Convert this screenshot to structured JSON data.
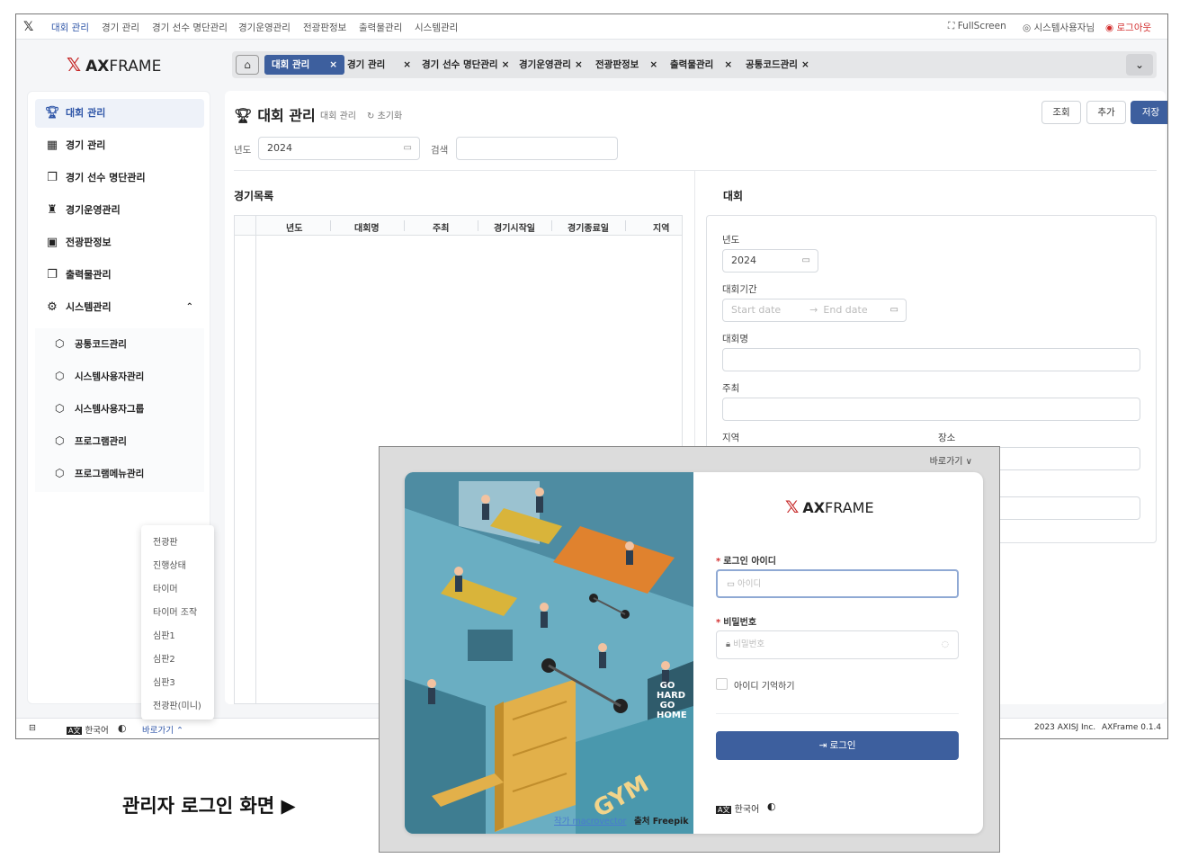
{
  "topmenu": {
    "items": [
      "대회 관리",
      "경기 관리",
      "경기 선수 명단관리",
      "경기운영관리",
      "전광판정보",
      "출력물관리",
      "시스템관리"
    ],
    "fullscreen": "FullScreen",
    "user": "시스템사용자님",
    "logout": "로그아웃"
  },
  "logo": {
    "bold": "AX",
    "light": "FRAME"
  },
  "tabs": [
    "대회 관리",
    "경기 관리",
    "경기 선수 명단관리",
    "경기운영관리",
    "전광판정보",
    "출력물관리",
    "공통코드관리"
  ],
  "sidebar": {
    "items": [
      {
        "label": "대회 관리",
        "icon": "trophy-icon"
      },
      {
        "label": "경기 관리",
        "icon": "calendar-icon"
      },
      {
        "label": "경기 선수 명단관리",
        "icon": "documents-icon"
      },
      {
        "label": "경기운영관리",
        "icon": "operation-icon"
      },
      {
        "label": "전광판정보",
        "icon": "board-icon"
      },
      {
        "label": "출력물관리",
        "icon": "print-docs-icon"
      },
      {
        "label": "시스템관리",
        "icon": "gear-icon"
      }
    ],
    "subitems": [
      "공통코드관리",
      "시스템사용자관리",
      "시스템사용자그룹",
      "프로그램관리",
      "프로그램메뉴관리"
    ]
  },
  "page": {
    "title": "대회 관리",
    "breadcrumb": "대회 관리",
    "reset": "초기화",
    "buttons": {
      "search": "조회",
      "add": "추가",
      "save": "저장"
    },
    "filter": {
      "year_label": "년도",
      "year_value": "2024",
      "search_label": "검색"
    },
    "list_title": "경기목록",
    "columns": [
      "년도",
      "대회명",
      "주최",
      "경기시작일",
      "경기종료일",
      "지역"
    ],
    "form_title": "대회",
    "form": {
      "year_label": "년도",
      "year_value": "2024",
      "period_label": "대회기간",
      "start_placeholder": "Start date",
      "end_placeholder": "End date",
      "name_label": "대회명",
      "host_label": "주최",
      "region_label": "지역",
      "place_label": "장소"
    }
  },
  "footer": {
    "language": "한국어",
    "goto": "바로가기",
    "copyright": "2023 AXISJ Inc.",
    "version": "AXFrame 0.1.4"
  },
  "dropdown": [
    "전광판",
    "진행상태",
    "타이머",
    "타이머 조작",
    "심판1",
    "심판2",
    "심판3",
    "전광판(미니)"
  ],
  "caption": "관리자 로그인 화면 ▶",
  "login": {
    "goto": "바로가기",
    "id_label": "로그인 아이디",
    "id_placeholder": "아이디",
    "pw_label": "비밀번호",
    "pw_placeholder": "비밀번호",
    "remember": "아이디 기억하기",
    "button": "로그인",
    "language": "한국어",
    "credit_author": "작가 macrovector",
    "credit_source": "출처 Freepik",
    "gym_sign": "GYM",
    "poster": "GO HARD GO HOME"
  },
  "colors": {
    "accent": "#3d5f9e",
    "logout": "#d32f2f",
    "brand_mark": "#c62828"
  }
}
